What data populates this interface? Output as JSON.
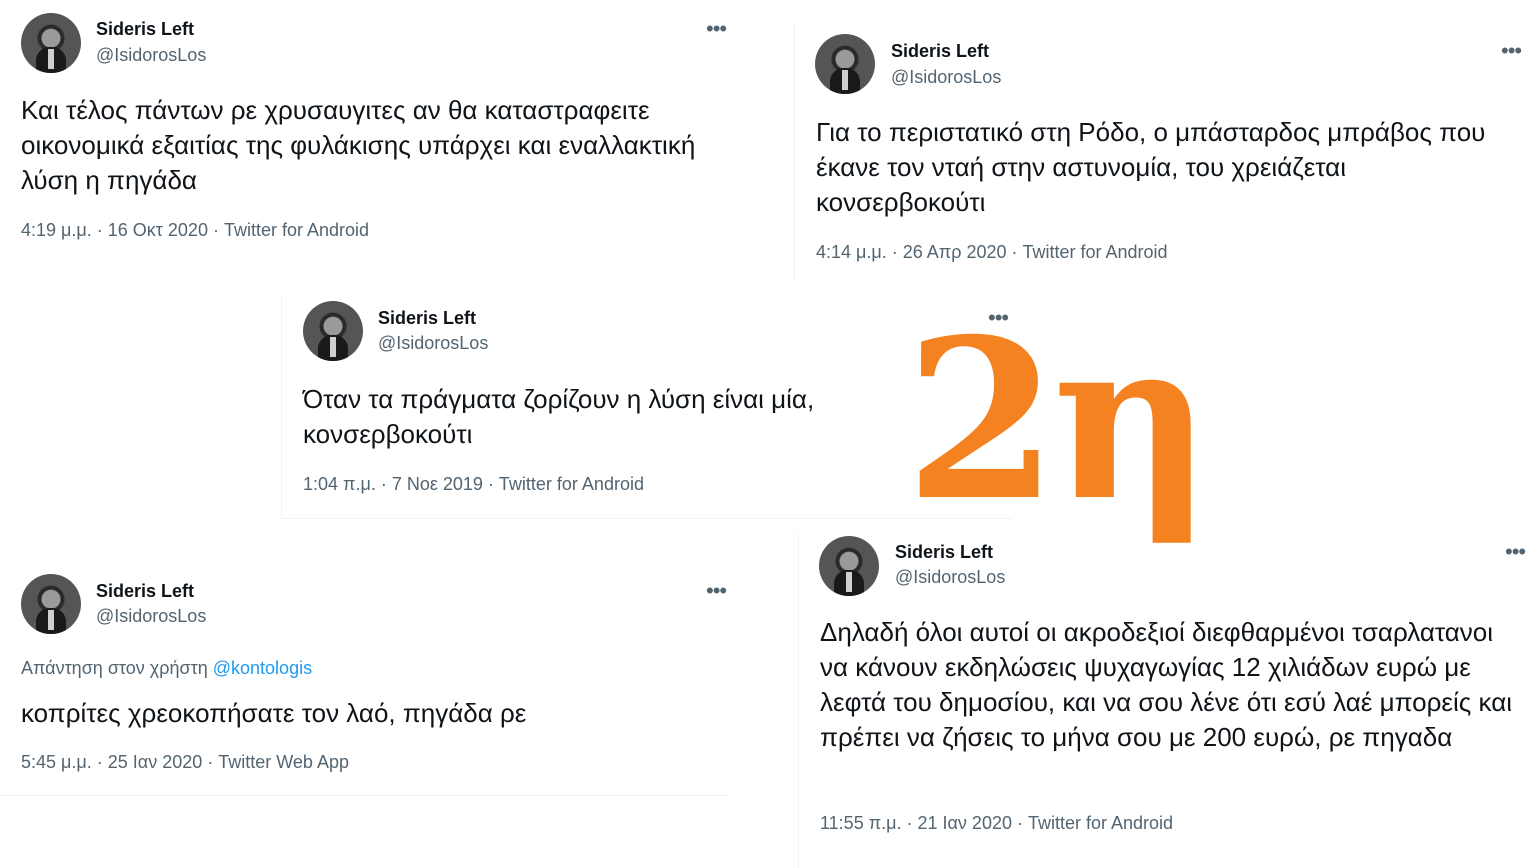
{
  "tweets": [
    {
      "name": "Sideris Left",
      "handle": "@IsidorosLos",
      "more_label": "•••",
      "text": "Και τέλος πάντων ρε χρυσαυγιτες αν θα καταστραφειτε οικονομικά εξαιτίας της φυλάκισης υπάρχει και εναλλακτική λύση η πηγάδα",
      "meta": "4:19 μ.μ. · 16 Οκτ 2020 · Twitter for Android"
    },
    {
      "name": "Sideris Left",
      "handle": "@IsidorosLos",
      "more_label": "•••",
      "text": "Για το περιστατικό στη Ρόδο, ο μπάσταρδος μπράβος που έκανε τον νταή στην αστυνομία, του χρειάζεται κονσερβοκούτι",
      "meta": "4:14 μ.μ. · 26 Απρ 2020 · Twitter for Android"
    },
    {
      "name": "Sideris Left",
      "handle": "@IsidorosLos",
      "more_label": "•••",
      "text": "Όταν τα πράγματα ζορίζουν η λύση είναι μία, κονσερβοκούτι",
      "meta": "1:04 π.μ. · 7 Νοε 2019 · Twitter for Android"
    },
    {
      "name": "Sideris Left",
      "handle": "@IsidorosLos",
      "more_label": "•••",
      "reply_prefix": "Απάντηση στον χρήστη",
      "reply_mention": "@kontologis",
      "text": "κοπρίτες χρεοκοπήσατε τον λαό, πηγάδα ρε",
      "meta": "5:45 μ.μ. · 25 Ιαν 2020 · Twitter Web App"
    },
    {
      "name": "Sideris Left",
      "handle": "@IsidorosLos",
      "more_label": "•••",
      "text": "Δηλαδή όλοι αυτοί οι ακροδεξιοί διεφθαρμένοι τσαρλατανοι να κάνουν εκδηλώσεις ψυχαγωγίας 12 χιλιάδων ευρώ με λεφτά του δημοσίου, και να σου λένε ότι εσύ λαέ μπορείς και πρέπει να ζήσεις το μήνα σου με 200 ευρώ, ρε πηγαδα",
      "meta": "11:55 π.μ. · 21 Ιαν 2020 · Twitter for Android"
    }
  ],
  "overlay": {
    "label": "2η",
    "color": "#f58220"
  }
}
